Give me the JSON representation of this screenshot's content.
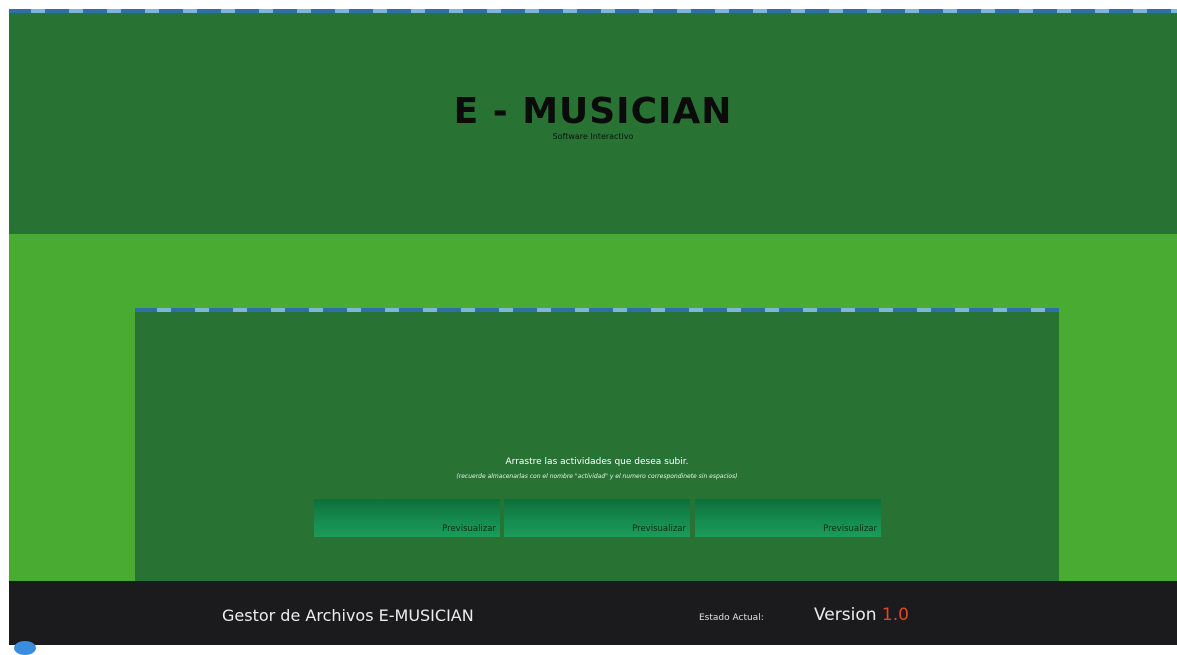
{
  "header": {
    "title": "E - MUSICIAN",
    "subtitle": "Software Interactivo"
  },
  "panel": {
    "instructions": "Arrastre las actividades que desea subir.",
    "hint": "(recuerde almacenarlas con el nombre \"actividad\" y el numero correspondinete sin espacios)",
    "slots": [
      {
        "label": "Previsualizar"
      },
      {
        "label": "Previsualizar"
      },
      {
        "label": "Previsualizar"
      }
    ]
  },
  "footer": {
    "title": "Gestor de Archivos E-MUSICIAN",
    "status_label": "Estado Actual:",
    "version_label": "Version",
    "version_number": "1.0"
  },
  "colors": {
    "dark_green": "#287233",
    "light_green": "#49ab31",
    "footer_bg": "#1b1a1d",
    "version_accent": "#e5451e"
  }
}
